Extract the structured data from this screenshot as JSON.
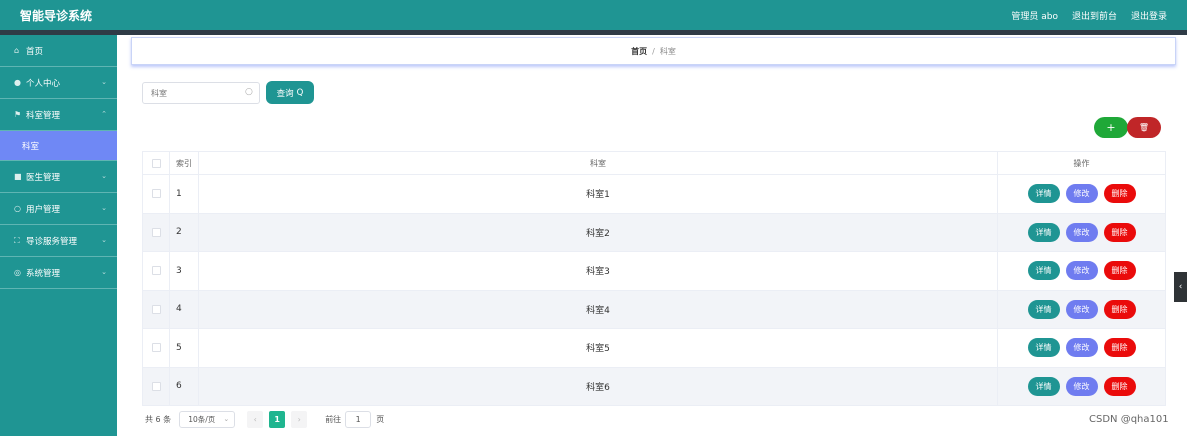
{
  "header": {
    "title": "智能导诊系统",
    "admin_label": "管理员 abo",
    "back_label": "退出到前台",
    "logout_label": "退出登录"
  },
  "sidebar": {
    "items": [
      {
        "label": "首页",
        "icon": "home-icon"
      },
      {
        "label": "个人中心",
        "icon": "user-icon"
      },
      {
        "label": "科室管理",
        "icon": "flag-icon"
      },
      {
        "label": "科室",
        "icon": ""
      },
      {
        "label": "医生管理",
        "icon": "doctor-icon"
      },
      {
        "label": "用户管理",
        "icon": "users-icon"
      },
      {
        "label": "导诊服务管理",
        "icon": "service-icon"
      },
      {
        "label": "系统管理",
        "icon": "settings-icon"
      }
    ]
  },
  "breadcrumb": {
    "home": "首页",
    "separator": "/",
    "current": "科室"
  },
  "search": {
    "placeholder": "科室",
    "button_label": "查询"
  },
  "table": {
    "headers": {
      "index": "索引",
      "name": "科室",
      "ops": "操作"
    },
    "rows": [
      {
        "index": "1",
        "name": "科室1"
      },
      {
        "index": "2",
        "name": "科室2"
      },
      {
        "index": "3",
        "name": "科室3"
      },
      {
        "index": "4",
        "name": "科室4"
      },
      {
        "index": "5",
        "name": "科室5"
      },
      {
        "index": "6",
        "name": "科室6"
      }
    ],
    "actions": {
      "detail": "详情",
      "edit": "修改",
      "delete": "删除"
    }
  },
  "pagination": {
    "total": "共 6 条",
    "page_size": "10条/页",
    "current_page": "1",
    "goto_label": "前往",
    "goto_value": "1",
    "page_suffix": "页"
  },
  "watermark": "CSDN @qha101",
  "colors": {
    "primary": "#1f9593",
    "active_menu": "#6f88f5",
    "add": "#1fa838",
    "delete": "#ea0b0b"
  }
}
